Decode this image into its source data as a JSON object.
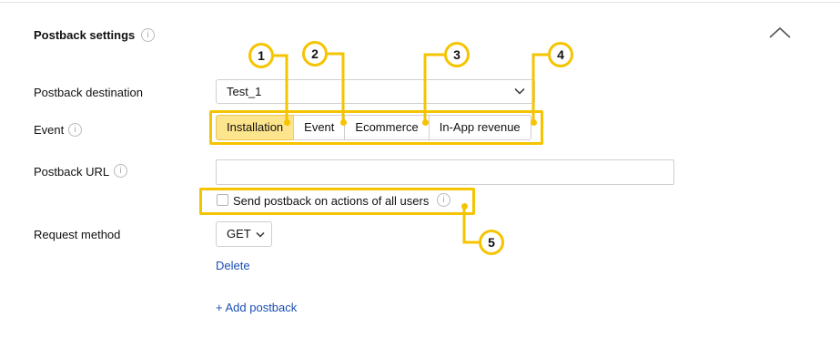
{
  "section": {
    "title": "Postback settings"
  },
  "fields": {
    "destination_label": "Postback destination",
    "destination_value": "Test_1",
    "event_label": "Event",
    "url_label": "Postback URL",
    "url_value": "",
    "checkbox_label": "Send postback on actions of all users",
    "checkbox_checked": false,
    "method_label": "Request method",
    "method_value": "GET"
  },
  "events": {
    "tabs": [
      {
        "label": "Installation",
        "active": true
      },
      {
        "label": "Event",
        "active": false
      },
      {
        "label": "Ecommerce",
        "active": false
      },
      {
        "label": "In-App revenue",
        "active": false
      }
    ]
  },
  "links": {
    "delete": "Delete",
    "add_postback": "+ Add postback"
  },
  "annotations": [
    "1",
    "2",
    "3",
    "4",
    "5"
  ],
  "icons": {
    "info": "info-icon",
    "collapse": "chevron-up-icon",
    "dropdown": "chevron-down-icon"
  },
  "colors": {
    "highlight": "#f5c400",
    "active_tab": "#fde58d",
    "link": "#1a4fb5"
  }
}
